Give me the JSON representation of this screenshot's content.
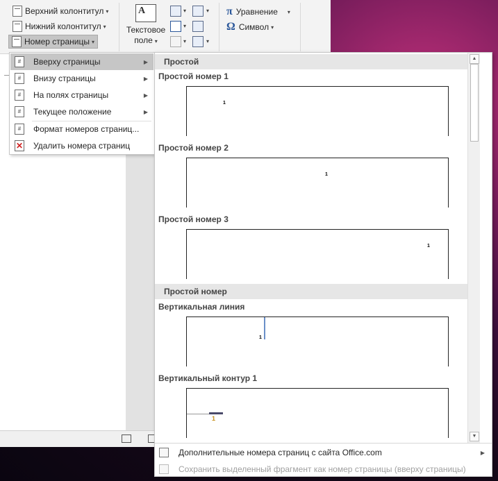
{
  "ribbon": {
    "header": "Верхний колонтитул",
    "footer": "Нижний колонтитул",
    "page_number": "Номер страницы",
    "textbox_line1": "Текстовое",
    "textbox_line2": "поле",
    "equation": "Уравнение",
    "symbol": "Символ",
    "equation_glyph": "π",
    "symbol_glyph": "Ω"
  },
  "menu": {
    "items": [
      {
        "label": "Вверху страницы",
        "icon": "page-top-icon",
        "has_submenu": true,
        "highlighted": true
      },
      {
        "label": "Внизу страницы",
        "icon": "page-bottom-icon",
        "has_submenu": true
      },
      {
        "label": "На полях страницы",
        "icon": "page-margin-icon",
        "has_submenu": true
      },
      {
        "label": "Текущее положение",
        "icon": "current-position-icon",
        "has_submenu": true
      },
      {
        "label": "Формат номеров страниц...",
        "icon": "format-numbers-icon",
        "has_submenu": false
      },
      {
        "label": "Удалить номера страниц",
        "icon": "remove-numbers-icon",
        "has_submenu": false
      }
    ],
    "glyph": "#"
  },
  "gallery": {
    "section1": "Простой",
    "items1": [
      {
        "title": "Простой номер 1",
        "num": "1"
      },
      {
        "title": "Простой номер 2",
        "num": "1"
      },
      {
        "title": "Простой номер 3",
        "num": "1"
      }
    ],
    "section2": "Простой номер",
    "items2": [
      {
        "title": "Вертикальная линия",
        "num": "1"
      },
      {
        "title": "Вертикальный контур 1",
        "num": "1"
      }
    ],
    "footer_more": "Дополнительные номера страниц с сайта Office.com",
    "footer_save": "Сохранить выделенный фрагмент как номер страницы (вверху страницы)"
  },
  "colors": {
    "accent": "#2b579a",
    "menu_highlight": "#c6c6c6",
    "section_header": "#e6e6e6",
    "remove_icon": "#d02020"
  }
}
